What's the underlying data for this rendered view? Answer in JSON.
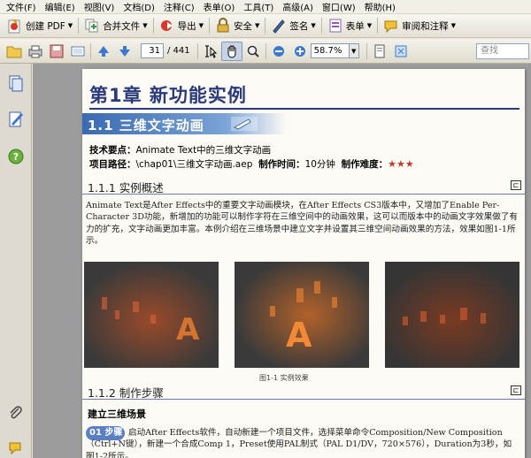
{
  "menu": [
    "文件(F)",
    "编辑(E)",
    "视图(V)",
    "文档(D)",
    "注释(C)",
    "表单(O)",
    "工具(T)",
    "高级(A)",
    "窗口(W)",
    "帮助(H)"
  ],
  "toolbar": {
    "create_pdf": "创建 PDF",
    "combine": "合并文件",
    "export": "导出",
    "security": "安全",
    "sign": "签名",
    "forms": "表单",
    "review": "审阅和注释"
  },
  "nav": {
    "current_page": "31",
    "total_pages": "/ 441",
    "zoom": "58.7%",
    "search_placeholder": "查找"
  },
  "doc": {
    "chapter_title": "第1章  新功能实例",
    "section_title": "1.1  三维文字动画",
    "meta1_label": "技术要点：",
    "meta1_value": "Animate Text中的三维文字动画",
    "meta2_label": "项目路径：",
    "meta2_value": "\\chap01\\三维文字动画.aep",
    "meta2_time_label": "制作时间：",
    "meta2_time_value": "10分钟",
    "meta2_diff_label": "制作难度：",
    "meta2_diff_value": "★★★",
    "sub1": "1.1.1  实例概述",
    "para1": "Animate Text是After Effects中的重要文字动画模块，在After Effects CS3版本中，又增加了Enable Per-Character 3D功能，新增加的功能可以制作字符在三维空间中的动画效果，这可以而版本中的动画文字效果做了有力的扩充，文字动画更加丰富。本例介绍在三维场景中建立文字并设置其三维空间动画效果的方法，效果如图1-1所示。",
    "fig_caption": "图1-1  实例效果",
    "sub2": "1.1.2  制作步骤",
    "block_title": "建立三维场景",
    "step_badge": "01 步骤",
    "para2": "启动After Effects软件，自动新建一个项目文件，选择菜单命令Composition/New Composition（Ctrl+N键），新建一个合成Comp 1，Preset使用PAL制式（PAL D1/DV，720×576），Duration为3秒，如图1-2所示。"
  }
}
